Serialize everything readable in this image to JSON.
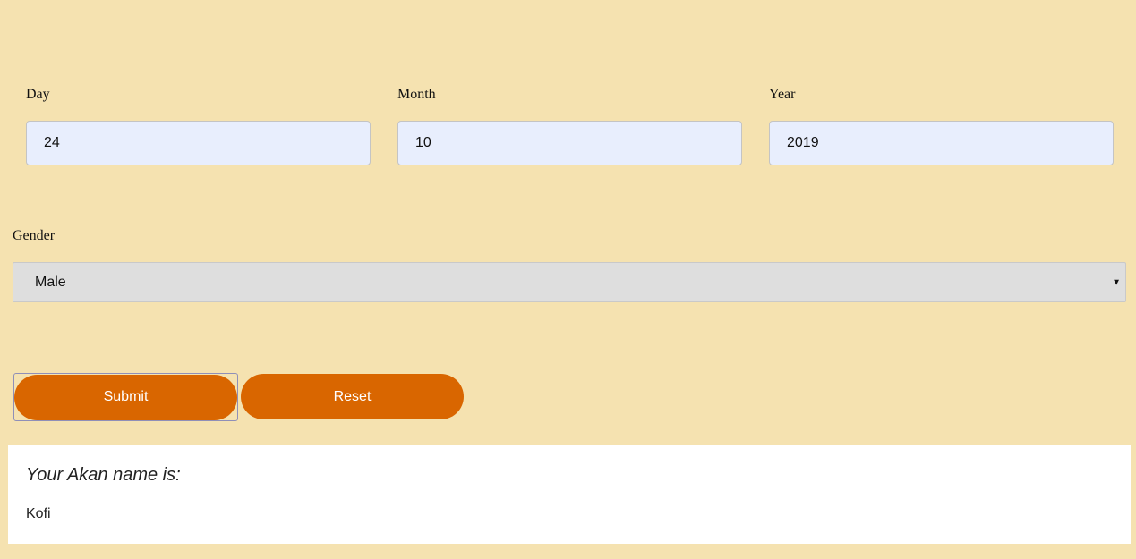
{
  "form": {
    "day": {
      "label": "Day",
      "value": "24"
    },
    "month": {
      "label": "Month",
      "value": "10"
    },
    "year": {
      "label": "Year",
      "value": "2019"
    },
    "gender": {
      "label": "Gender",
      "selected": "Male"
    },
    "submit_label": "Submit",
    "reset_label": "Reset"
  },
  "result": {
    "heading": "Your Akan name is:",
    "name": "Kofi"
  },
  "icons": {
    "select_arrow": "caret-down-icon"
  },
  "colors": {
    "background": "#f5e2b0",
    "button": "#d96600",
    "input_bg": "#e8eefd"
  }
}
